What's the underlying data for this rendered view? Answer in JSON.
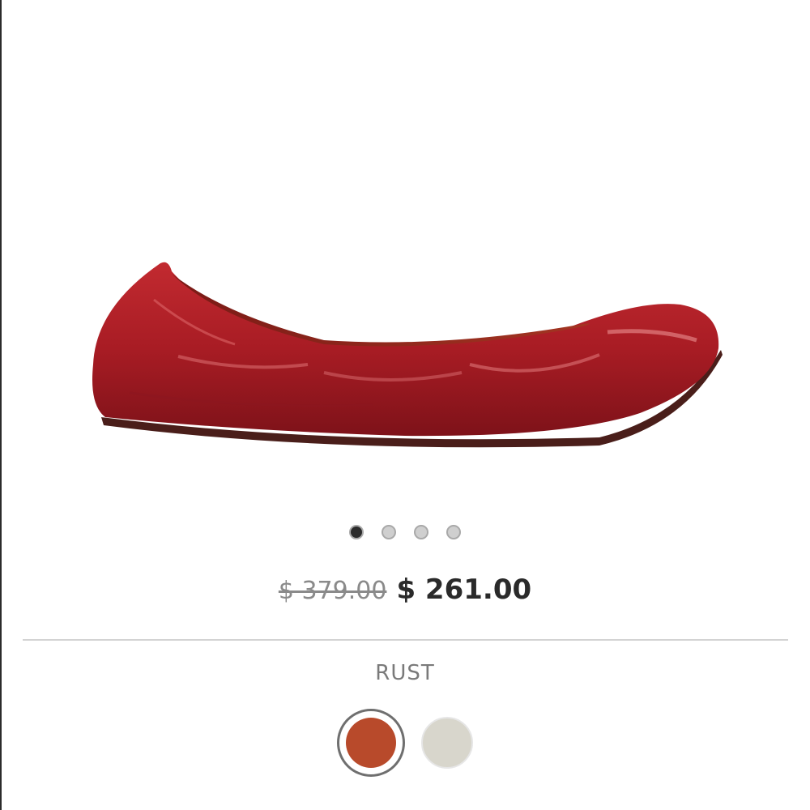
{
  "carousel": {
    "slide_count": 4,
    "active_index": 0
  },
  "pricing": {
    "original_price": "$ 379.00",
    "sale_price": "$ 261.00"
  },
  "color_selector": {
    "selected_color_name": "RUST",
    "options": [
      {
        "name": "RUST",
        "hex": "#b84a2b",
        "selected": true
      },
      {
        "name": "",
        "hex": "#d8d6cc",
        "selected": false
      }
    ]
  },
  "colors": {
    "shoe_red": "#a81c24",
    "sole": "#4a1e1a",
    "divider": "#d3d3d3",
    "active_dot": "#2c2c2c",
    "inactive_dot": "#cfcfcf"
  },
  "icons": {
    "product_image": "red-leather-ballet-flat"
  }
}
